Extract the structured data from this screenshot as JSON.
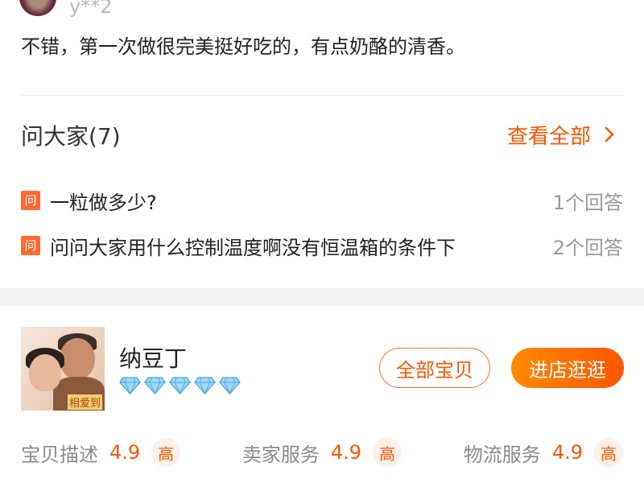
{
  "review": {
    "username": "y**2",
    "text": "不错，第一次做很完美挺好吃的，有点奶酪的清香。"
  },
  "qa": {
    "title": "问大家(7)",
    "view_all": "查看全部",
    "view_all_icon": "chevron-right-icon",
    "badge": "问",
    "questions": [
      {
        "text": "一粒做多少?",
        "answers": "1个回答"
      },
      {
        "text": "问问大家用什么控制温度啊没有恒温箱的条件下",
        "answers": "2个回答"
      }
    ]
  },
  "shop": {
    "name": "纳豆丁",
    "logo_text": "相爱到",
    "level_icon": "diamond-icon",
    "level_count": 5,
    "all_items_label": "全部宝贝",
    "enter_shop_label": "进店逛逛",
    "ratings": [
      {
        "label": "宝贝描述",
        "score": "4.9",
        "level": "高"
      },
      {
        "label": "卖家服务",
        "score": "4.9",
        "level": "高"
      },
      {
        "label": "物流服务",
        "score": "4.9",
        "level": "高"
      }
    ]
  },
  "colors": {
    "accent": "#ff5500",
    "badge": "#ff6a33",
    "diamond": "#7ec8f0"
  }
}
